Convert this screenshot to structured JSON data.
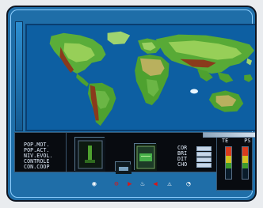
{
  "menus": {
    "left": [
      "POP.MOT.",
      "POP.ACT.",
      "NIV.EVOL.",
      "CONTROLE",
      "CON.COOP"
    ],
    "right": [
      "COR",
      "BRI",
      "DIT",
      "CHO"
    ]
  },
  "gauges": [
    {
      "label": "TE",
      "fills": [
        0.18,
        0.22,
        0.18
      ]
    },
    {
      "label": "PS",
      "fills": [
        0.18,
        0.22,
        0.18
      ]
    }
  ],
  "icons": [
    "globe-icon",
    "minus-icon",
    "right-arrow-icon",
    "fire-icon",
    "left-arrow-icon",
    "warning-icon",
    "disk-icon"
  ],
  "colors": {
    "ocean": "#0d5fa2",
    "land_green": "#4ea12f",
    "land_light": "#97cf58",
    "desert": "#b9b05e",
    "mountains": "#8a3a1c",
    "panel": "#1f6ea8"
  }
}
